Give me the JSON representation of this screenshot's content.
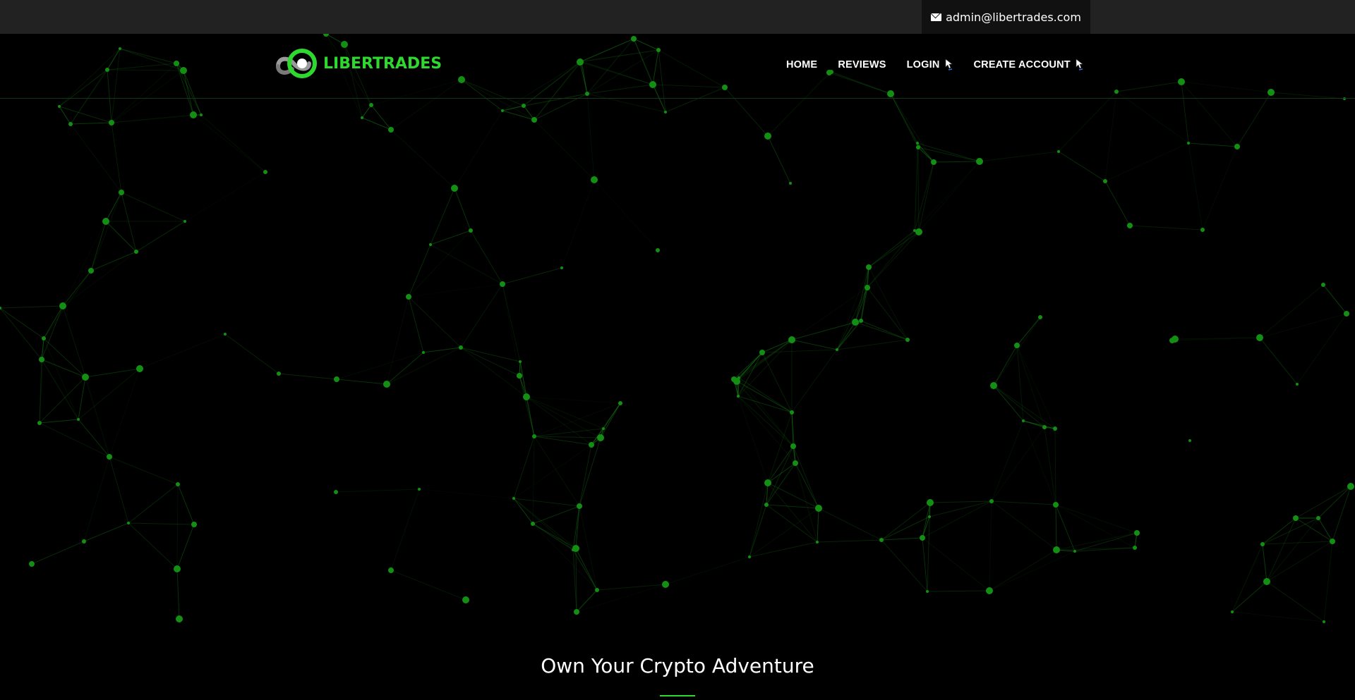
{
  "topbar": {
    "email": "admin@libertrades.com",
    "email_icon": "envelope-icon"
  },
  "brand": {
    "name": "LIBERTRADES",
    "logo_icon": "infinity-logo",
    "accent_color": "#2ed82e"
  },
  "nav": {
    "items": [
      {
        "label": "HOME"
      },
      {
        "label": "REVIEWS"
      },
      {
        "label": "LOGIN",
        "icon": "cursor-icon"
      },
      {
        "label": "CREATE ACCOUNT",
        "icon": "cursor-icon"
      }
    ]
  },
  "hero": {
    "title": "Own Your Crypto Adventure"
  },
  "colors": {
    "background": "#000000",
    "topbar": "#222222",
    "email_box": "#111111",
    "network_green": "#1a9a1a"
  }
}
